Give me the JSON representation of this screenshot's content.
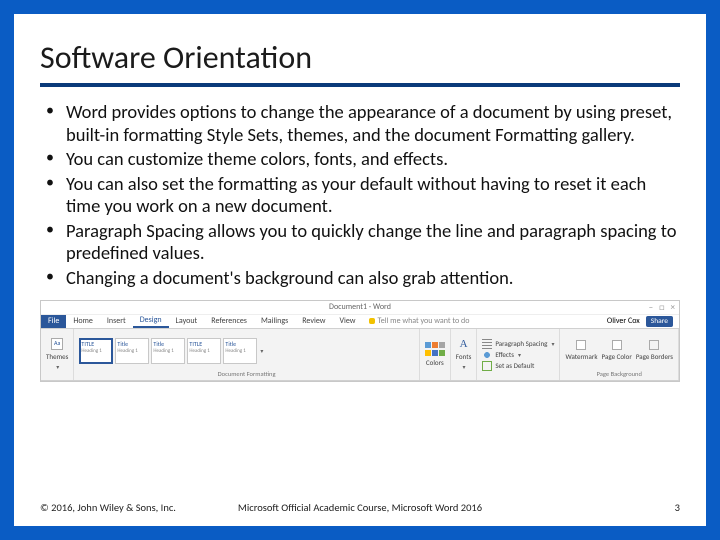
{
  "slide": {
    "title": "Software Orientation",
    "bullets": [
      "Word provides options to change the appearance of a document by using preset, built-in formatting Style Sets, themes, and the document Formatting gallery.",
      "You can customize theme colors, fonts, and effects.",
      "You can also set the formatting as your default without having to reset it each time you work on a new document.",
      "Paragraph Spacing allows you to quickly change the line and paragraph spacing to predefined values.",
      "Changing a document's background can also grab attention."
    ]
  },
  "ribbon": {
    "app_title": "Document1 - Word",
    "win_controls": [
      "–",
      "□",
      "×"
    ],
    "tabs": {
      "file": "File",
      "list": [
        "Home",
        "Insert",
        "Design",
        "Layout",
        "References",
        "Mailings",
        "Review",
        "View"
      ],
      "active": "Design",
      "tell_me": "Tell me what you want to do"
    },
    "user": "Oliver Cox",
    "share": "Share",
    "groups": {
      "themes": {
        "button": "Themes",
        "label": ""
      },
      "doc_formatting": {
        "styles": [
          "TITLE",
          "Title",
          "Title",
          "TITLE",
          "Title"
        ],
        "label": "Document Formatting"
      },
      "colors": {
        "button": "Colors",
        "palette": [
          "#ffffff",
          "#000000",
          "#e7e6e6",
          "#44546a",
          "#5b9bd5",
          "#ed7d31",
          "#a5a5a5",
          "#ffc000",
          "#4472c4",
          "#70ad47"
        ]
      },
      "fonts": {
        "button": "Fonts"
      },
      "spacing_default": {
        "paragraph_spacing": "Paragraph Spacing",
        "effects": "Effects",
        "set_default": "Set as Default"
      },
      "page_background": {
        "watermark": "Watermark",
        "page_color": "Page Color",
        "page_borders": "Page Borders",
        "label": "Page Background"
      }
    }
  },
  "footer": {
    "copyright": "© 2016, John Wiley & Sons, Inc.",
    "course": "Microsoft Official Academic Course, Microsoft Word 2016",
    "page": "3"
  }
}
